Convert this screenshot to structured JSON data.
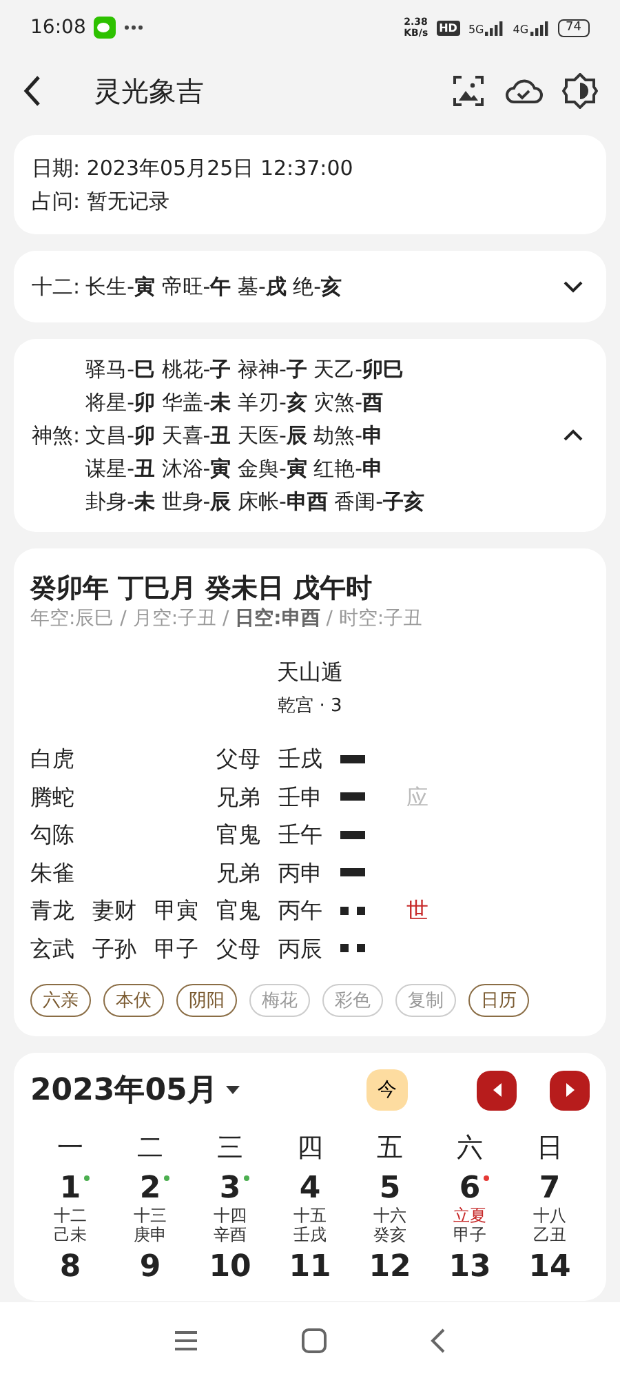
{
  "status_bar": {
    "time": "16:08",
    "speed_value": "2.38",
    "speed_unit": "KB/s",
    "hd": "HD",
    "networks": [
      "5G",
      "4G"
    ],
    "battery": "74"
  },
  "header": {
    "title": "灵光象吉"
  },
  "info": {
    "lines": [
      "日期: 2023年05月25日 12:37:00",
      "占问: 暂无记录"
    ]
  },
  "twelve": {
    "label": "十二:",
    "text": "长生-**寅** 帝旺-**午** 墓-**戌** 绝-**亥**",
    "expanded": false
  },
  "shensha": {
    "label": "神煞:",
    "expanded": true,
    "lines": [
      "驿马-**巳** 桃花-**子** 禄神-**子** 天乙-**卯巳**",
      "将星-**卯** 华盖-**未** 羊刃-**亥** 灾煞-**酉**",
      "文昌-**卯** 天喜-**丑** 天医-**辰** 劫煞-**申**",
      "谋星-**丑** 沐浴-**寅** 金舆-**寅** 红艳-**申**",
      "卦身-**未** 世身-**辰** 床帐-**申酉** 香闺-**子亥**"
    ]
  },
  "gua": {
    "title": "癸卯年 丁巳月 癸未日 戊午时",
    "kong": "年空:辰巳 / 月空:子丑 / **日空:申酉** / 时空:子丑",
    "name": "天山遁",
    "palace": "乾宫 · 3",
    "lines": [
      {
        "god": "白虎",
        "relation": "父母",
        "branch": "壬戌",
        "kind": "yang"
      },
      {
        "god": "腾蛇",
        "relation": "兄弟",
        "branch": "壬申",
        "kind": "yang",
        "mark": {
          "text": "应",
          "kind": "ying"
        }
      },
      {
        "god": "勾陈",
        "relation": "官鬼",
        "branch": "壬午",
        "kind": "yang"
      },
      {
        "god": "朱雀",
        "relation": "兄弟",
        "branch": "丙申",
        "kind": "yang"
      },
      {
        "god": "青龙",
        "fu_relation": "妻财",
        "fu_branch": "甲寅",
        "relation": "官鬼",
        "branch": "丙午",
        "kind": "yin",
        "mark": {
          "text": "世",
          "kind": "shi"
        }
      },
      {
        "god": "玄武",
        "fu_relation": "子孙",
        "fu_branch": "甲子",
        "relation": "父母",
        "branch": "丙辰",
        "kind": "yin"
      }
    ],
    "chips": [
      {
        "label": "六亲",
        "on": true
      },
      {
        "label": "本伏",
        "on": true
      },
      {
        "label": "阴阳",
        "on": true
      },
      {
        "label": "梅花",
        "on": false
      },
      {
        "label": "彩色",
        "on": false
      },
      {
        "label": "复制",
        "on": false
      },
      {
        "label": "日历",
        "on": true
      }
    ]
  },
  "calendar": {
    "title": "2023年05月",
    "today": "今",
    "weekdays": [
      "一",
      "二",
      "三",
      "四",
      "五",
      "六",
      "日"
    ],
    "days": [
      {
        "day": "1",
        "lunar": "十二",
        "ganzhi": "己未",
        "solar_term": false,
        "color": "#4caf50"
      },
      {
        "day": "2",
        "lunar": "十三",
        "ganzhi": "庚申",
        "solar_term": false,
        "color": "#4caf50"
      },
      {
        "day": "3",
        "lunar": "十四",
        "ganzhi": "辛酉",
        "solar_term": false,
        "color": "#4caf50"
      },
      {
        "day": "4",
        "lunar": "十五",
        "ganzhi": "壬戌",
        "solar_term": false
      },
      {
        "day": "5",
        "lunar": "十六",
        "ganzhi": "癸亥",
        "solar_term": false
      },
      {
        "day": "6",
        "lunar": "立夏",
        "ganzhi": "甲子",
        "solar_term": true,
        "color": "#e53935"
      },
      {
        "day": "7",
        "lunar": "十八",
        "ganzhi": "乙丑",
        "solar_term": false
      },
      {
        "day": "8"
      },
      {
        "day": "9"
      },
      {
        "day": "10"
      },
      {
        "day": "11"
      },
      {
        "day": "12"
      },
      {
        "day": "13"
      },
      {
        "day": "14"
      }
    ]
  }
}
